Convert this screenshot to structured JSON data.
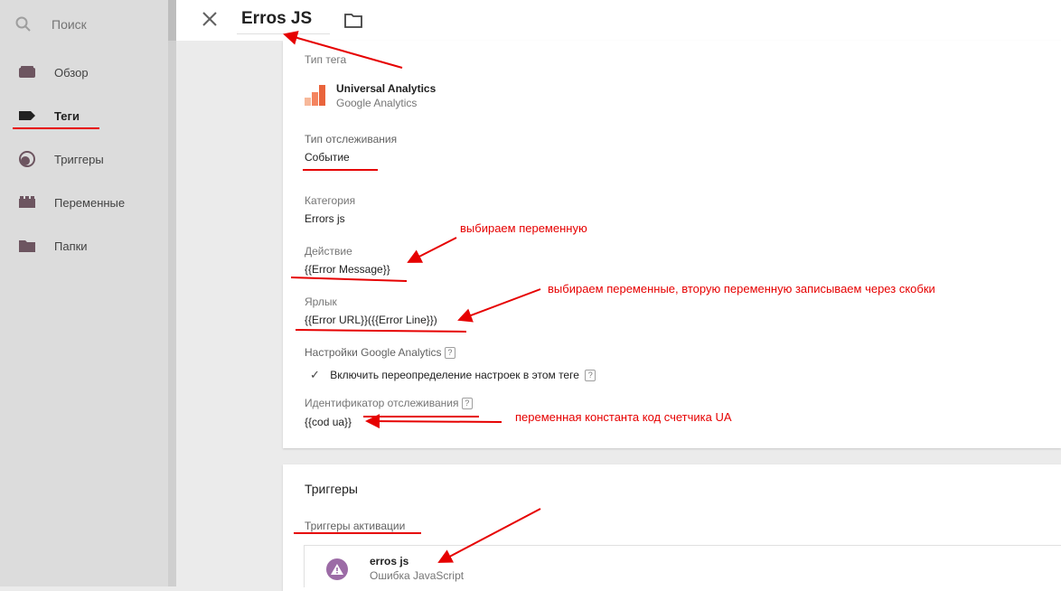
{
  "sidebar": {
    "search_label": "Поиск",
    "items": [
      {
        "label": "Обзор",
        "icon": "overview-icon"
      },
      {
        "label": "Теги",
        "icon": "tag-icon",
        "active": true
      },
      {
        "label": "Триггеры",
        "icon": "trigger-icon"
      },
      {
        "label": "Переменные",
        "icon": "variables-icon"
      },
      {
        "label": "Папки",
        "icon": "folder-icon"
      }
    ]
  },
  "header": {
    "title": "Erros JS"
  },
  "tag_config": {
    "tag_type_label": "Тип тега",
    "tag_type_name": "Universal Analytics",
    "tag_type_vendor": "Google Analytics",
    "track_type_label": "Тип отслеживания",
    "track_type_value": "Событие",
    "category_label": "Категория",
    "category_value": "Errors js",
    "action_label": "Действие",
    "action_value": "{{Error Message}}",
    "tag_label_label": "Ярлык",
    "tag_label_value": "{{Error URL}}({{Error Line}})",
    "ga_settings_label": "Настройки Google Analytics",
    "override_label": "Включить переопределение настроек в этом теге",
    "tracking_id_label": "Идентификатор отслеживания",
    "tracking_id_value": "{{cod ua}}",
    "help_glyph": "?",
    "check_glyph": "✓"
  },
  "triggers": {
    "title": "Триггеры",
    "firing_label": "Триггеры активации",
    "trigger_name": "erros js",
    "trigger_type": "Ошибка JavaScript",
    "warning_glyph": "!"
  },
  "annotations": {
    "note_action": "выбираем переменную",
    "note_label": "выбираем переменные, вторую переменную записываем через скобки",
    "note_tracking": "переменная константа код счетчика UA"
  },
  "colors": {
    "annotation_red": "#e60000",
    "ga_orange": "#f57c00",
    "trigger_purple": "#9c6ba6"
  }
}
